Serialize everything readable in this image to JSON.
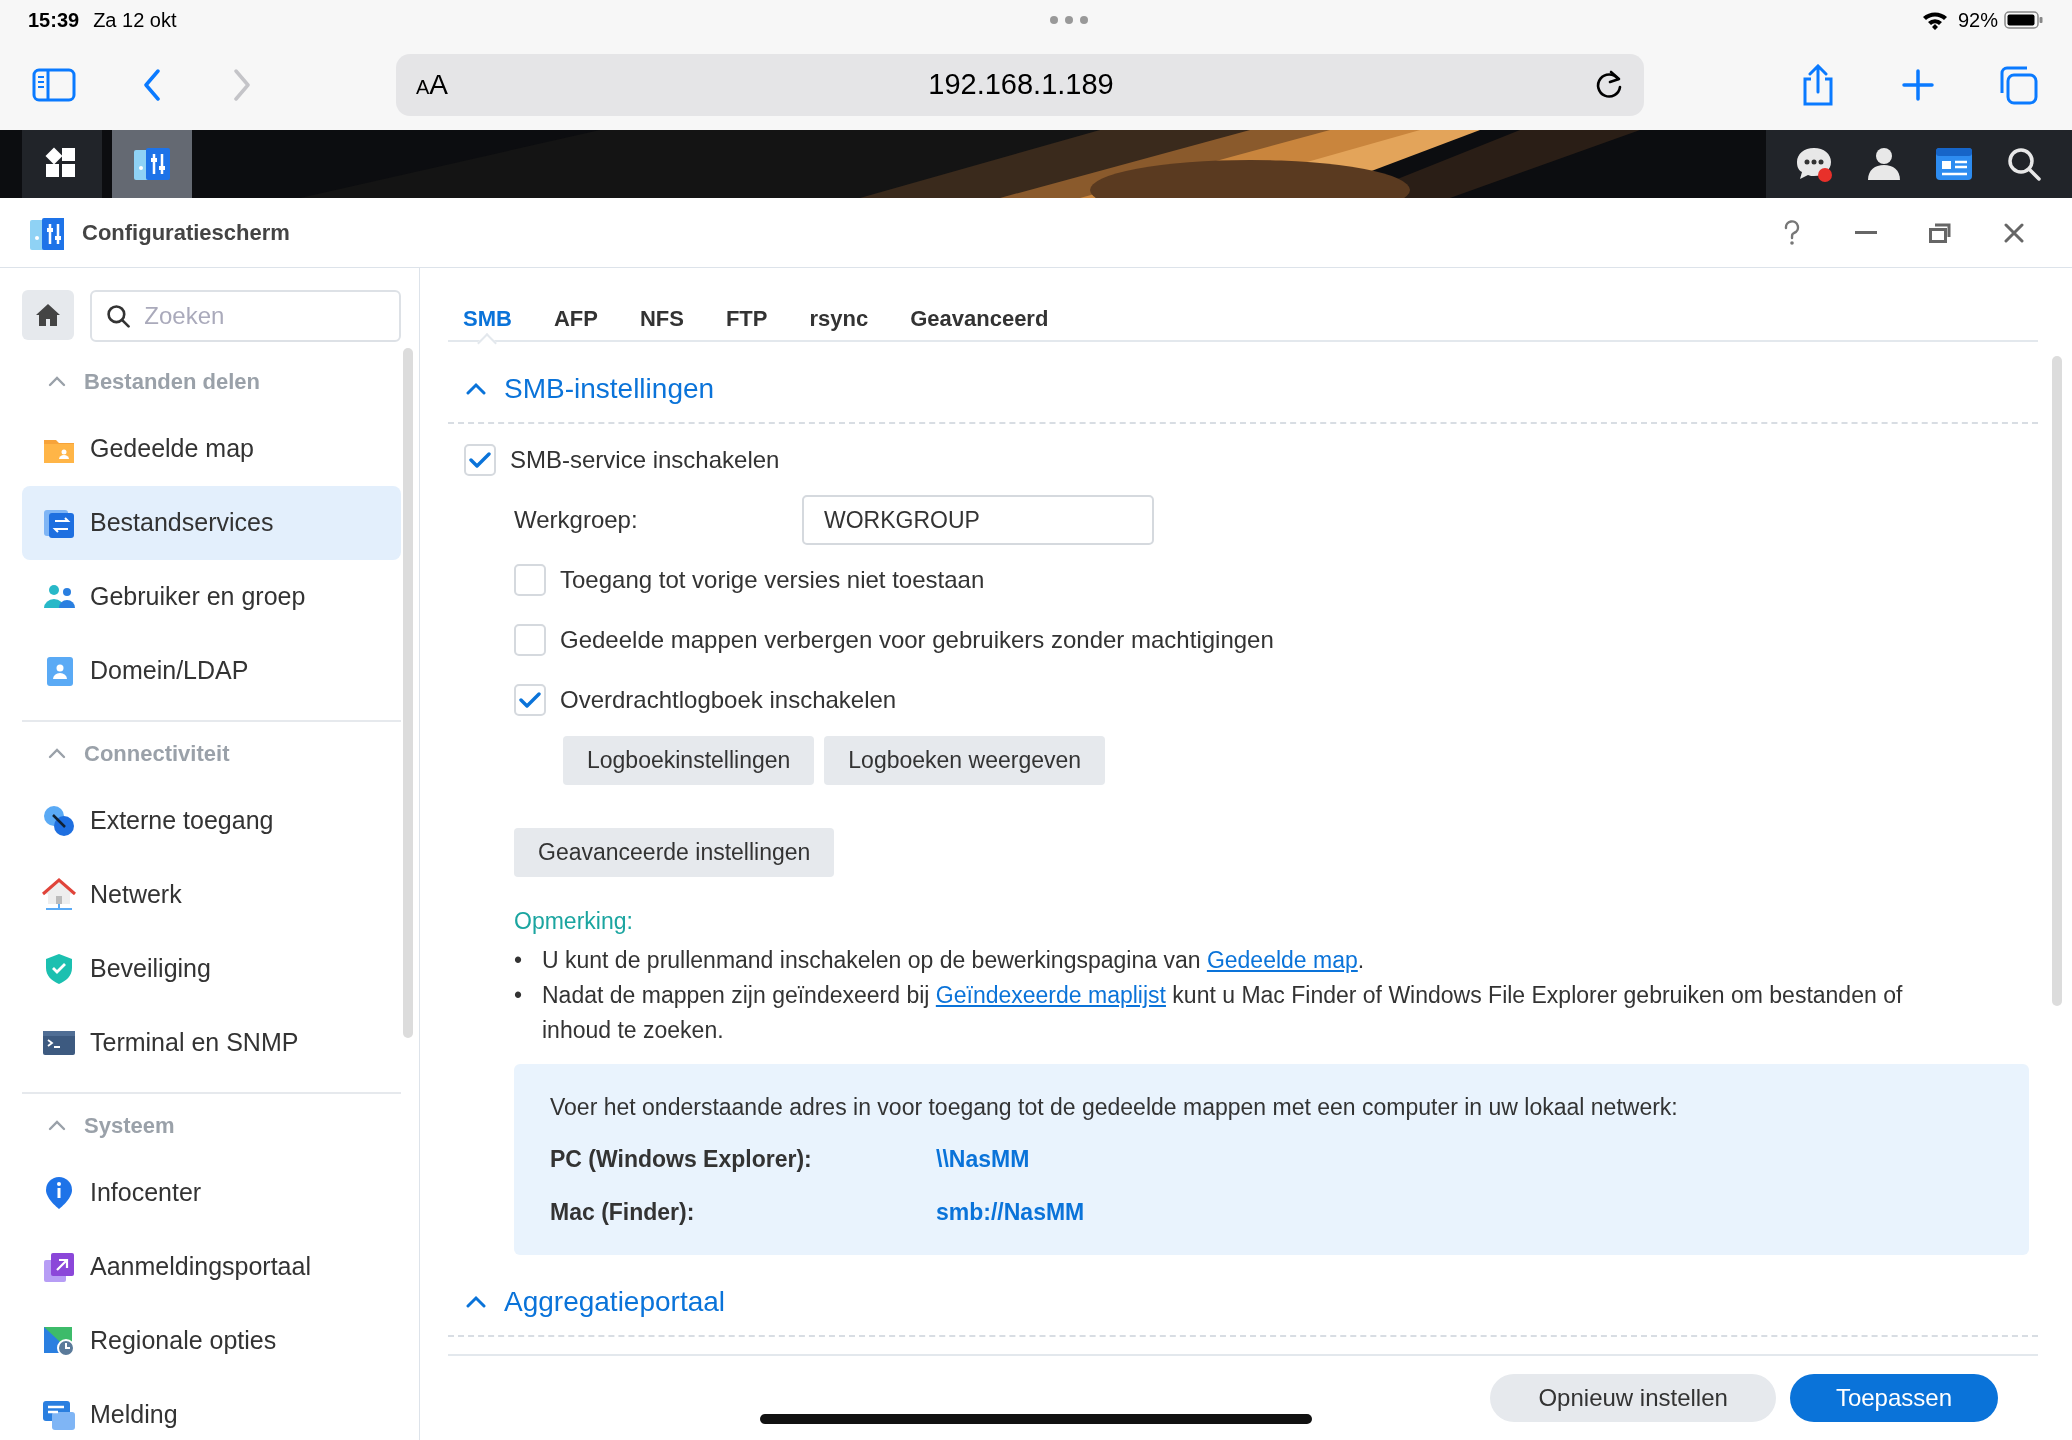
{
  "status_bar": {
    "time": "15:39",
    "date": "Za 12 okt",
    "battery": "92%"
  },
  "browser": {
    "text_size_button": "AA",
    "url": "192.168.1.189",
    "forward_disabled": true
  },
  "taskbar": {
    "apps": [
      {
        "selected": false
      },
      {
        "selected": true
      }
    ],
    "notification_badge": true
  },
  "window": {
    "title": "Configuratiescherm"
  },
  "sidebar": {
    "search": {
      "placeholder": "Zoeken"
    },
    "groups": [
      {
        "title": "Bestanden delen",
        "expanded": true,
        "items": [
          {
            "label": "Gedeelde map",
            "selected": false
          },
          {
            "label": "Bestandservices",
            "selected": true
          },
          {
            "label": "Gebruiker en groep",
            "selected": false
          },
          {
            "label": "Domein/LDAP",
            "selected": false
          }
        ]
      },
      {
        "title": "Connectiviteit",
        "expanded": true,
        "items": [
          {
            "label": "Externe toegang",
            "selected": false
          },
          {
            "label": "Netwerk",
            "selected": false
          },
          {
            "label": "Beveiliging",
            "selected": false
          },
          {
            "label": "Terminal en SNMP",
            "selected": false
          }
        ]
      },
      {
        "title": "Systeem",
        "expanded": true,
        "items": [
          {
            "label": "Infocenter",
            "selected": false
          },
          {
            "label": "Aanmeldingsportaal",
            "selected": false
          },
          {
            "label": "Regionale opties",
            "selected": false
          },
          {
            "label": "Melding",
            "selected": false
          }
        ]
      }
    ]
  },
  "tabs": [
    {
      "label": "SMB",
      "selected": true
    },
    {
      "label": "AFP",
      "selected": false
    },
    {
      "label": "NFS",
      "selected": false
    },
    {
      "label": "FTP",
      "selected": false
    },
    {
      "label": "rsync",
      "selected": false
    },
    {
      "label": "Geavanceerd",
      "selected": false
    }
  ],
  "sections": [
    {
      "title": "SMB-instellingen",
      "expanded": true,
      "rows": [
        {
          "kind": "checkbox",
          "label": "SMB-service inschakelen",
          "checked": true
        },
        {
          "kind": "field",
          "label": "Werkgroep:",
          "value": "WORKGROUP"
        },
        {
          "kind": "sub_checkbox",
          "label": "Toegang tot vorige versies niet toestaan",
          "checked": false
        },
        {
          "kind": "sub_checkbox",
          "label": "Gedeelde mappen verbergen voor gebruikers zonder machtigingen",
          "checked": false
        },
        {
          "kind": "sub_checkbox",
          "label": "Overdrachtlogboek inschakelen",
          "checked": true
        },
        {
          "kind": "buttons",
          "buttons": [
            "Logboekinstellingen",
            "Logboeken weergeven"
          ]
        },
        {
          "kind": "button",
          "label": "Geavanceerde instellingen"
        }
      ],
      "note": {
        "title": "Opmerking:",
        "bullets": [
          {
            "marker": "•",
            "before": "U kunt de prullenmand inschakelen op de bewerkingspagina van ",
            "link": "Gedeelde map",
            "after": "."
          },
          {
            "marker": "•",
            "before": "Nadat de mappen zijn geïndexeerd bij ",
            "link": "Geïndexeerde maplijst",
            "after": " kunt u Mac Finder of Windows File Explorer gebruiken om bestanden of inhoud te zoeken."
          }
        ]
      },
      "info_box": {
        "intro": "Voer het onderstaande adres in voor toegang tot de gedeelde mappen met een computer in uw lokaal netwerk:",
        "rows": [
          {
            "label": "PC (Windows Explorer):",
            "value": "\\\\NasMM"
          },
          {
            "label": "Mac (Finder):",
            "value": "smb://NasMM"
          }
        ]
      }
    },
    {
      "title": "Aggregatieportaal",
      "expanded": true
    }
  ],
  "footer_buttons": [
    {
      "label": "Opnieuw instellen",
      "kind": "secondary"
    },
    {
      "label": "Toepassen",
      "kind": "primary"
    }
  ]
}
